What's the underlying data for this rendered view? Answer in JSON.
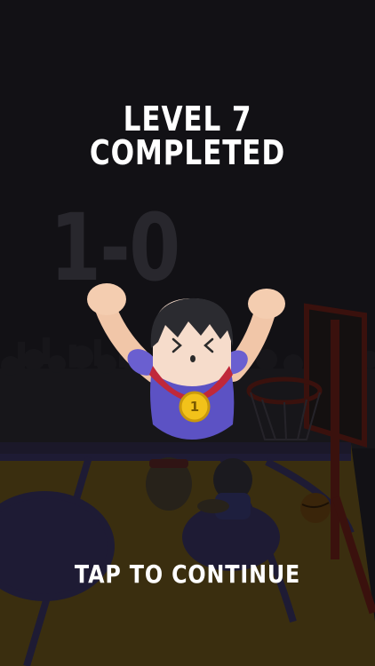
{
  "level_complete": {
    "title_line1": "LEVEL 7",
    "title_line2": "COMPLETED"
  },
  "scoreboard": {
    "score": "1-0"
  },
  "medal": {
    "number": "1"
  },
  "prompt": {
    "tap_to_continue": "TAP TO CONTINUE"
  },
  "colors": {
    "background": "#1c1b21",
    "court_floor": "#5a4818",
    "court_lines": "#2f2a50",
    "hoop": "#5a1b14",
    "character_shirt": "#6a5fd0",
    "medal_gold": "#f2c21a",
    "ribbon": "#c0283a"
  }
}
